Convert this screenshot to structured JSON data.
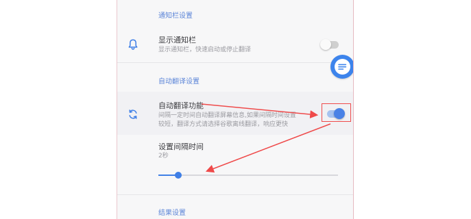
{
  "sections": {
    "notification": {
      "title": "通知栏设置"
    },
    "auto_translate": {
      "title": "自动翻译设置"
    },
    "result": {
      "title": "结果设置"
    }
  },
  "items": {
    "show_notification": {
      "title": "显示通知栏",
      "subtitle": "显示通知栏，快速启动或停止翻译",
      "icon": "bell-icon",
      "toggle_on": false
    },
    "auto_translate": {
      "title": "自动翻译功能",
      "subtitle_line1": "间隔一定时间自动翻译屏幕信息,如果间隔时间设置",
      "subtitle_line2": "较短，翻译方式请选择谷歌离线翻译，响应更快",
      "icon": "sync-arrows-icon",
      "toggle_on": true
    },
    "interval": {
      "title": "设置间隔时间",
      "value": "2秒",
      "slider_fraction": 0.11
    }
  },
  "floating_button": {
    "icon": "chat-bubble-icon"
  },
  "colors": {
    "accent": "#3f7fe6",
    "section_title": "#5d86d8",
    "annotation": "#ef4a4a"
  }
}
